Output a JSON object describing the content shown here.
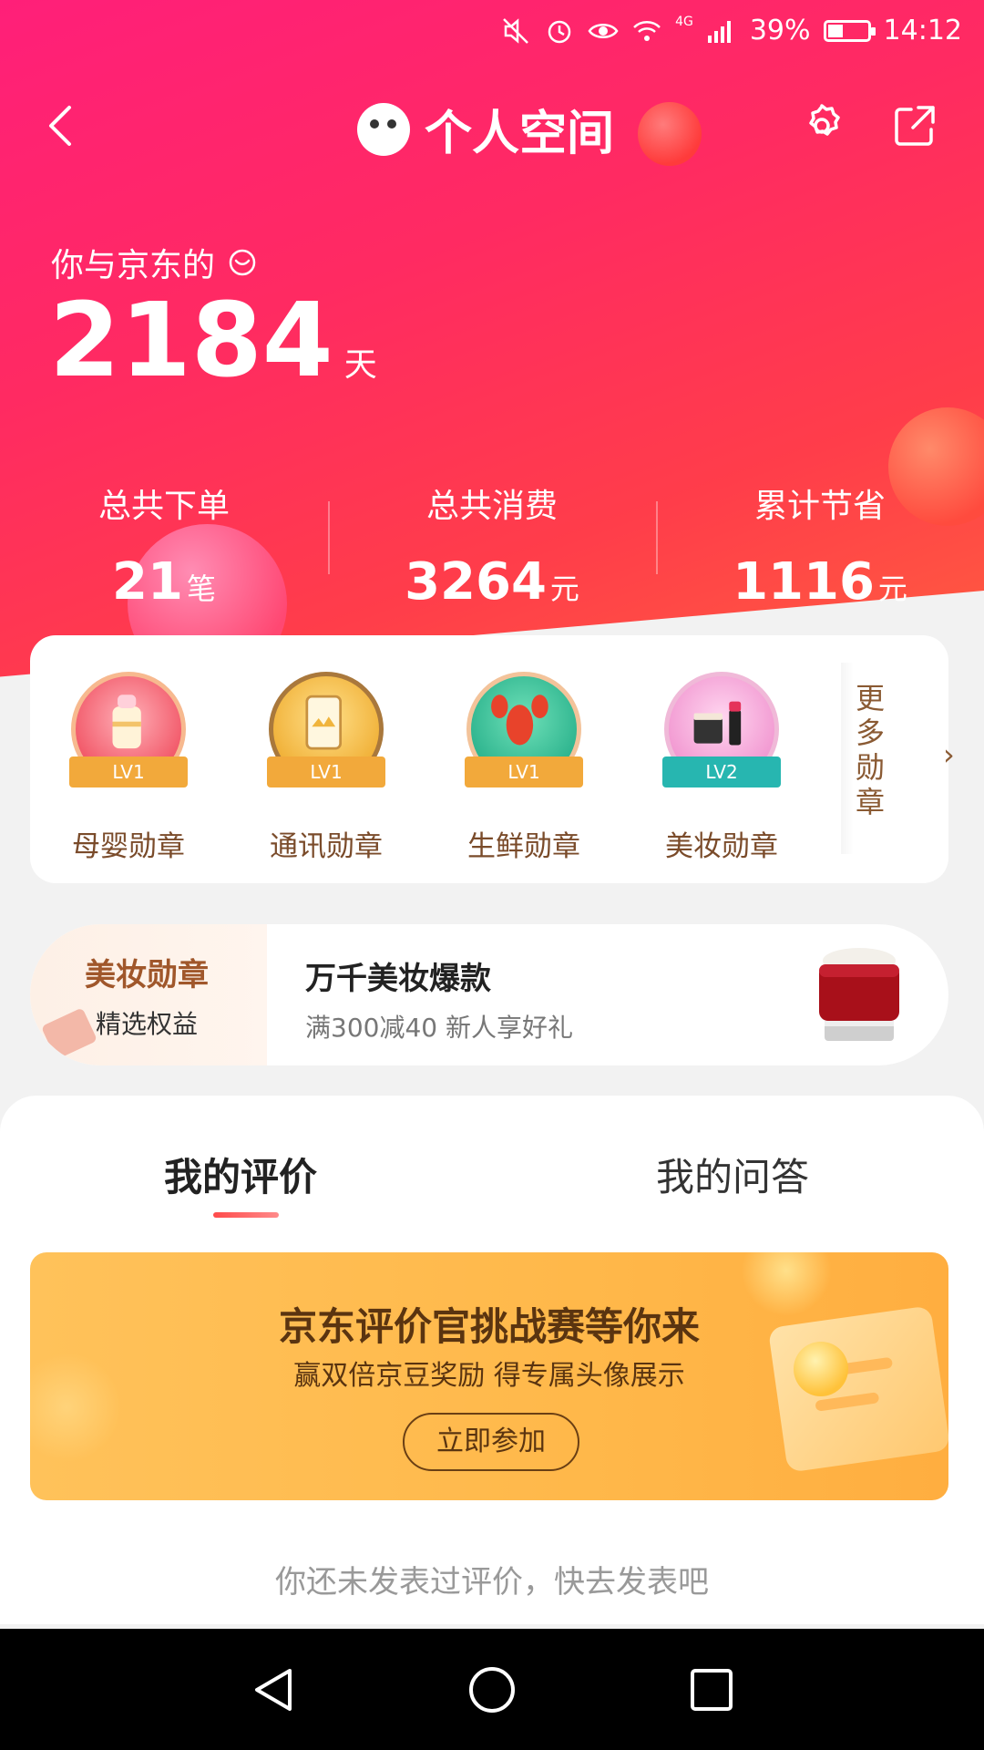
{
  "status_bar": {
    "battery": "39%",
    "time": "14:12",
    "network": "4G"
  },
  "nav": {
    "title": "个人空间"
  },
  "summary": {
    "days_label": "你与京东的",
    "days_value": "2184",
    "days_unit": "天"
  },
  "stats": [
    {
      "label": "总共下单",
      "value": "21",
      "unit": "笔"
    },
    {
      "label": "总共消费",
      "value": "3264",
      "unit": "元"
    },
    {
      "label": "累计节省",
      "value": "1116",
      "unit": "元"
    }
  ],
  "medals": {
    "items": [
      {
        "name": "母婴勋章",
        "level": "LV1"
      },
      {
        "name": "通讯勋章",
        "level": "LV1"
      },
      {
        "name": "生鲜勋章",
        "level": "LV1"
      },
      {
        "name": "美妆勋章",
        "level": "LV2"
      }
    ],
    "more_label": [
      "更",
      "多",
      "勋",
      "章"
    ],
    "more_arrow": "›"
  },
  "promo": {
    "badge_title": "美妆勋章",
    "badge_sub": "精选权益",
    "title": "万千美妆爆款",
    "subtitle": "满300减40   新人享好礼"
  },
  "tabs": [
    {
      "label": "我的评价",
      "active": true
    },
    {
      "label": "我的问答",
      "active": false
    }
  ],
  "challenge": {
    "title": "京东评价官挑战赛等你来",
    "subtitle": "赢双倍京豆奖励 得专属头像展示",
    "button": "立即参加"
  },
  "empty_note": "你还未发表过评价，快去发表吧",
  "colors": {
    "brand_pink": "#ff1f79",
    "brand_red": "#ff3d4a",
    "brand_orange": "#ff6b3a",
    "medal_gold": "#f2a93b",
    "medal_teal": "#27b6b0"
  }
}
